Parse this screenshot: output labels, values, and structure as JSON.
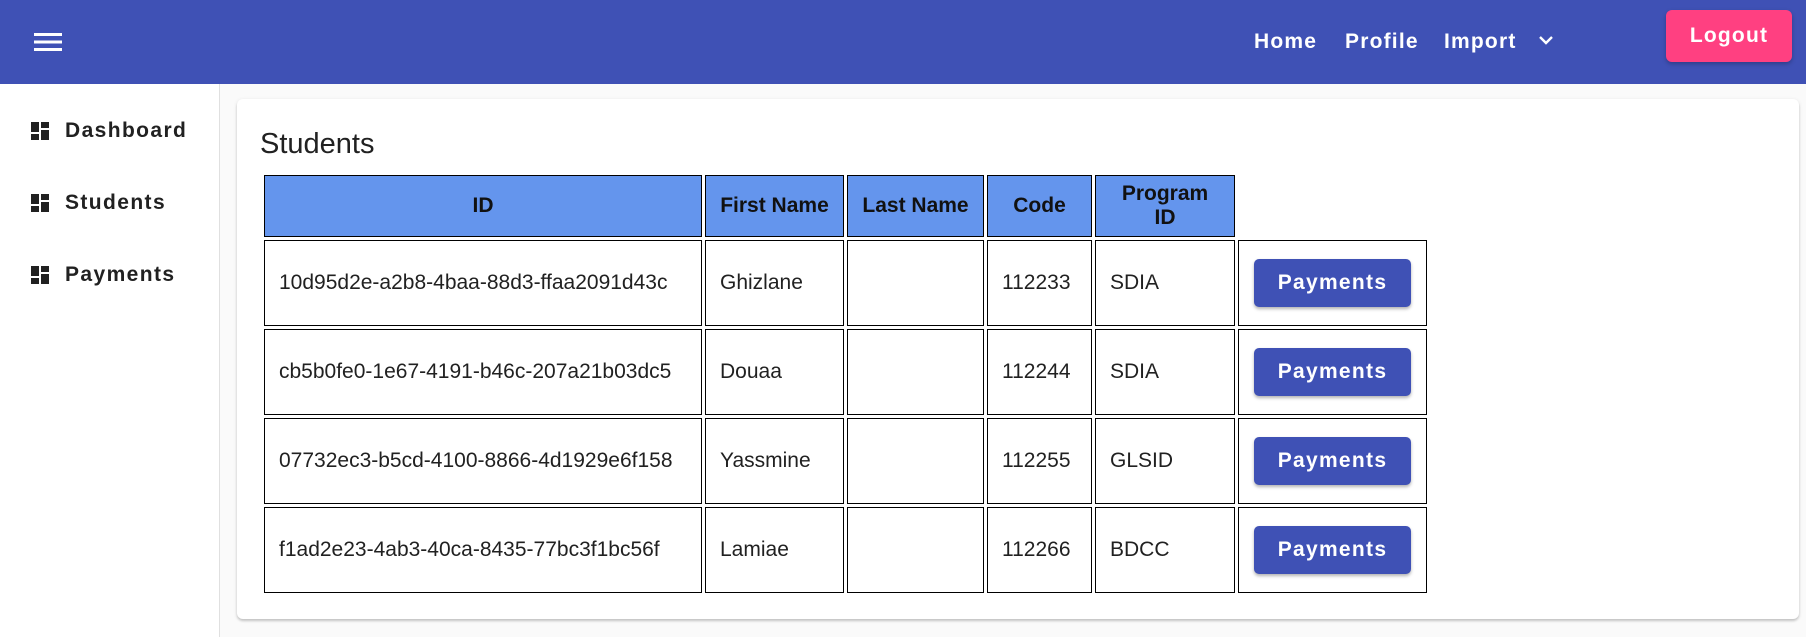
{
  "header": {
    "menu_icon": "hamburger-menu-icon",
    "nav": {
      "home": "Home",
      "profile": "Profile",
      "import": "Import"
    },
    "logout": "Logout",
    "colors": {
      "primary": "#3f51b5",
      "accent": "#ff4081"
    }
  },
  "sidebar": {
    "items": [
      {
        "label": "Dashboard",
        "icon": "dashboard-icon"
      },
      {
        "label": "Students",
        "icon": "dashboard-icon"
      },
      {
        "label": "Payments",
        "icon": "dashboard-icon"
      }
    ]
  },
  "main": {
    "title": "Students",
    "table": {
      "header_color": "#6495ed",
      "columns": [
        "ID",
        "First Name",
        "Last Name",
        "Code",
        "Program ID"
      ],
      "rows": [
        {
          "id": "10d95d2e-a2b8-4baa-88d3-ffaa2091d43c",
          "first_name": "Ghizlane",
          "last_name": "",
          "code": "112233",
          "program_id": "SDIA",
          "action": "Payments"
        },
        {
          "id": "cb5b0fe0-1e67-4191-b46c-207a21b03dc5",
          "first_name": "Douaa",
          "last_name": "",
          "code": "112244",
          "program_id": "SDIA",
          "action": "Payments"
        },
        {
          "id": "07732ec3-b5cd-4100-8866-4d1929e6f158",
          "first_name": "Yassmine",
          "last_name": "",
          "code": "112255",
          "program_id": "GLSID",
          "action": "Payments"
        },
        {
          "id": "f1ad2e23-4ab3-40ca-8435-77bc3f1bc56f",
          "first_name": "Lamiae",
          "last_name": "",
          "code": "112266",
          "program_id": "BDCC",
          "action": "Payments"
        }
      ]
    }
  }
}
